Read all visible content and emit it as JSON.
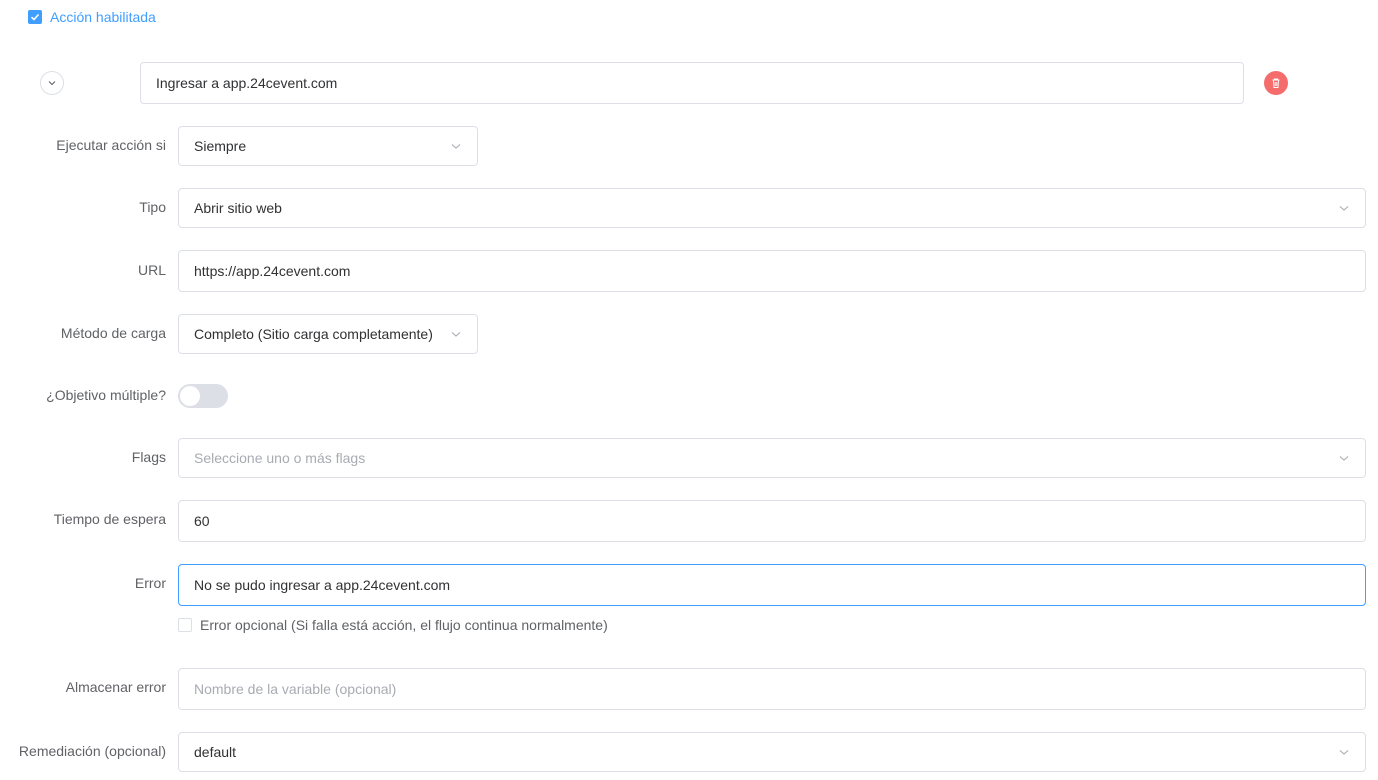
{
  "header": {
    "enabled_label": "Acción habilitada",
    "enabled_checked": true
  },
  "action": {
    "name_value": "Ingresar a app.24cevent.com"
  },
  "form": {
    "execute_if": {
      "label": "Ejecutar acción si",
      "value": "Siempre"
    },
    "type": {
      "label": "Tipo",
      "value": "Abrir sitio web"
    },
    "url": {
      "label": "URL",
      "value": "https://app.24cevent.com"
    },
    "load_method": {
      "label": "Método de carga",
      "value": "Completo (Sitio carga completamente)"
    },
    "multiple_target": {
      "label": "¿Objetivo múltiple?",
      "value": false
    },
    "flags": {
      "label": "Flags",
      "placeholder": "Seleccione uno o más flags"
    },
    "timeout": {
      "label": "Tiempo de espera",
      "value": "60"
    },
    "error": {
      "label": "Error",
      "value": "No se pudo ingresar a app.24cevent.com",
      "optional_label": "Error opcional (Si falla está acción, el flujo continua normalmente)",
      "optional_checked": false
    },
    "store_error": {
      "label": "Almacenar error",
      "placeholder": "Nombre de la variable (opcional)"
    },
    "remediation": {
      "label": "Remediación (opcional)",
      "value": "default"
    }
  },
  "icons": {
    "collapse": "chevron-down-icon",
    "delete": "trash-icon",
    "select_arrow": "chevron-down-icon",
    "checkbox_check": "check-icon"
  },
  "colors": {
    "primary": "#409eff",
    "danger": "#f56c6c",
    "border": "#dcdfe6",
    "text": "#303133",
    "label": "#606266",
    "placeholder": "#a8abb2"
  }
}
